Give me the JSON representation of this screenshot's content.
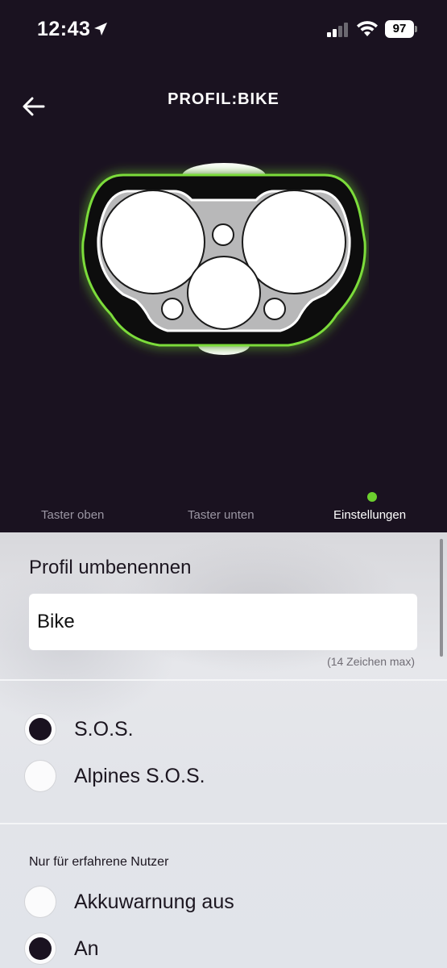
{
  "status_bar": {
    "time": "12:43",
    "battery": "97",
    "icons": [
      "location-arrow-icon",
      "cell-signal-icon",
      "wifi-icon",
      "battery-icon"
    ]
  },
  "nav": {
    "back_icon": "arrow-left-icon",
    "title": "PROFIL:BIKE"
  },
  "tabs": [
    {
      "label": "Taster oben",
      "active": false
    },
    {
      "label": "Taster unten",
      "active": false
    },
    {
      "label": "Einstellungen",
      "active": true
    }
  ],
  "rename": {
    "label": "Profil umbenennen",
    "value": "Bike",
    "hint": "(14 Zeichen max)"
  },
  "sos": {
    "options": [
      {
        "label": "S.O.S.",
        "selected": true
      },
      {
        "label": "Alpines S.O.S.",
        "selected": false
      }
    ]
  },
  "battery_warning": {
    "label": "Nur für erfahrene Nutzer",
    "options": [
      {
        "label": "Akkuwarnung aus",
        "selected": false
      },
      {
        "label": "An",
        "selected": true
      }
    ]
  },
  "colors": {
    "background_dark": "#1a1220",
    "accent_green": "#6ccf2e",
    "text_dark": "#1c1620"
  }
}
